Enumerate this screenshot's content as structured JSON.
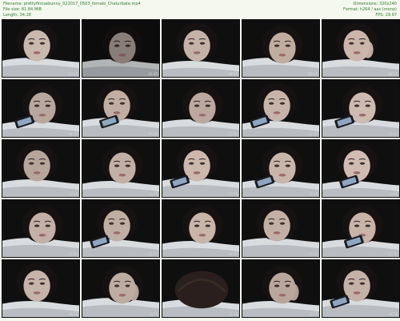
{
  "info": {
    "filename": "Filename: prettyfinnsebunny_022017_0503_female_Chaturbate.mp4",
    "filesize": "File size: 81.84 MiB",
    "length": "Length: 34:28",
    "dimensions": "Dimensions: 320x240",
    "format": "Format: h264 / aac (mono)",
    "fps": "FPS: 29.97"
  },
  "thumbnails": [
    {
      "time": "01:22",
      "scene": "face",
      "tone": "#c9b8ae"
    },
    {
      "time": "02:45",
      "scene": "face-dark",
      "tone": "#a89a92"
    },
    {
      "time": "04:08",
      "scene": "face",
      "tone": "#c4b2a8"
    },
    {
      "time": "05:31",
      "scene": "face",
      "tone": "#bfae9f"
    },
    {
      "time": "06:53",
      "scene": "face-hand",
      "tone": "#cbb5aa"
    },
    {
      "time": "08:16",
      "scene": "face-phone",
      "tone": "#b8a79e"
    },
    {
      "time": "09:39",
      "scene": "face-phone",
      "tone": "#c0ada3"
    },
    {
      "time": "11:02",
      "scene": "face",
      "tone": "#bba89e"
    },
    {
      "time": "12:25",
      "scene": "face-phone",
      "tone": "#c6b4aa"
    },
    {
      "time": "13:47",
      "scene": "face-phone",
      "tone": "#cdbbb2"
    },
    {
      "time": "15:10",
      "scene": "face",
      "tone": "#b6a59b"
    },
    {
      "time": "16:33",
      "scene": "face",
      "tone": "#c2afa5"
    },
    {
      "time": "17:56",
      "scene": "face-phone",
      "tone": "#cdb8ad"
    },
    {
      "time": "19:19",
      "scene": "face-phone",
      "tone": "#c9b6ab"
    },
    {
      "time": "20:41",
      "scene": "face-phone",
      "tone": "#d0bcb2"
    },
    {
      "time": "22:04",
      "scene": "face",
      "tone": "#c3b0a6"
    },
    {
      "time": "23:27",
      "scene": "face-phone",
      "tone": "#bfaea4"
    },
    {
      "time": "24:50",
      "scene": "face",
      "tone": "#c8b5aa"
    },
    {
      "time": "26:13",
      "scene": "face",
      "tone": "#c2b0a6"
    },
    {
      "time": "27:35",
      "scene": "face-phone",
      "tone": "#c9b4aa"
    },
    {
      "time": "28:58",
      "scene": "face",
      "tone": "#c6b3a9"
    },
    {
      "time": "30:21",
      "scene": "face-hand",
      "tone": "#bdaca2"
    },
    {
      "time": "31:44",
      "scene": "hair-down",
      "tone": "#8a7a70"
    },
    {
      "time": "33:07",
      "scene": "face-hand",
      "tone": "#b9a79d"
    },
    {
      "time": "34:28",
      "scene": "face-phone",
      "tone": "#c4b1a7"
    }
  ]
}
